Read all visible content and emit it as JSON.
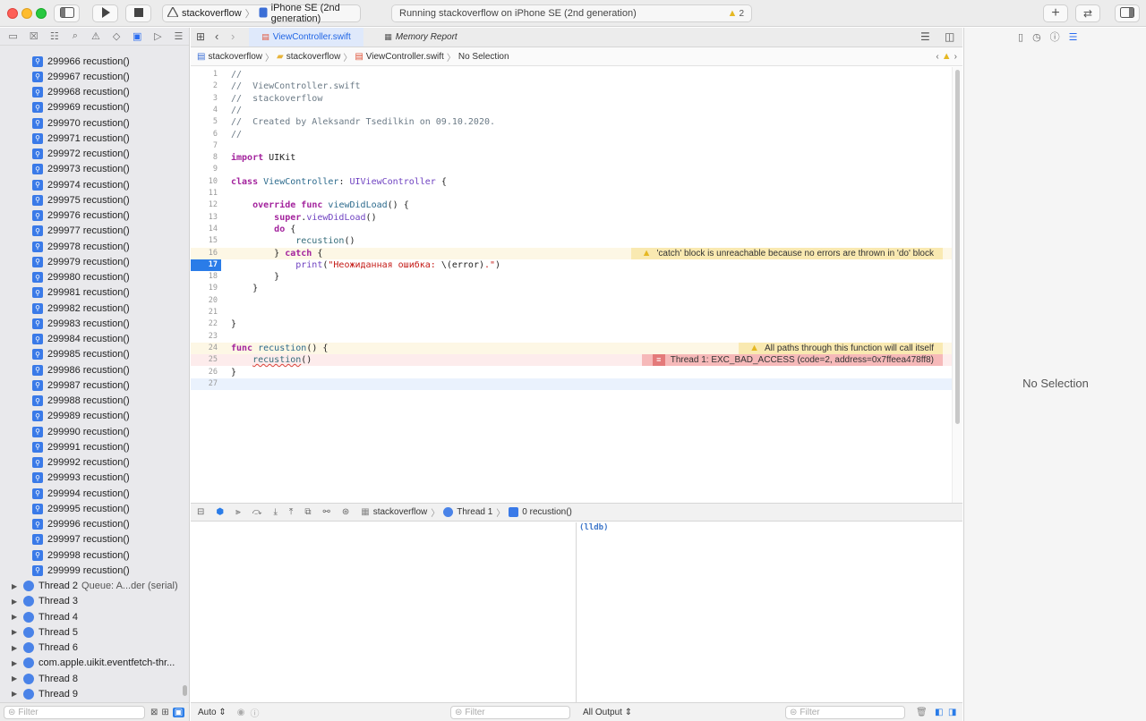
{
  "toolbar": {
    "scheme_project": "stackoverflow",
    "scheme_device": "iPhone SE (2nd generation)",
    "activity_status": "Running stackoverflow on iPhone SE (2nd generation)",
    "warning_count": "2"
  },
  "navigator": {
    "frames": [
      {
        "label": "299966 recustion()"
      },
      {
        "label": "299967 recustion()"
      },
      {
        "label": "299968 recustion()"
      },
      {
        "label": "299969 recustion()"
      },
      {
        "label": "299970 recustion()"
      },
      {
        "label": "299971 recustion()"
      },
      {
        "label": "299972 recustion()"
      },
      {
        "label": "299973 recustion()"
      },
      {
        "label": "299974 recustion()"
      },
      {
        "label": "299975 recustion()"
      },
      {
        "label": "299976 recustion()"
      },
      {
        "label": "299977 recustion()"
      },
      {
        "label": "299978 recustion()"
      },
      {
        "label": "299979 recustion()"
      },
      {
        "label": "299980 recustion()"
      },
      {
        "label": "299981 recustion()"
      },
      {
        "label": "299982 recustion()"
      },
      {
        "label": "299983 recustion()"
      },
      {
        "label": "299984 recustion()"
      },
      {
        "label": "299985 recustion()"
      },
      {
        "label": "299986 recustion()"
      },
      {
        "label": "299987 recustion()"
      },
      {
        "label": "299988 recustion()"
      },
      {
        "label": "299989 recustion()"
      },
      {
        "label": "299990 recustion()"
      },
      {
        "label": "299991 recustion()"
      },
      {
        "label": "299992 recustion()"
      },
      {
        "label": "299993 recustion()"
      },
      {
        "label": "299994 recustion()"
      },
      {
        "label": "299995 recustion()"
      },
      {
        "label": "299996 recustion()"
      },
      {
        "label": "299997 recustion()"
      },
      {
        "label": "299998 recustion()"
      },
      {
        "label": "299999 recustion()"
      }
    ],
    "threads": [
      {
        "label": "Thread 2",
        "sub": "Queue: A...der (serial)"
      },
      {
        "label": "Thread 3",
        "sub": ""
      },
      {
        "label": "Thread 4",
        "sub": ""
      },
      {
        "label": "Thread 5",
        "sub": ""
      },
      {
        "label": "Thread 6",
        "sub": ""
      },
      {
        "label": "com.apple.uikit.eventfetch-thr...",
        "sub": ""
      },
      {
        "label": "Thread 8",
        "sub": ""
      },
      {
        "label": "Thread 9",
        "sub": ""
      }
    ],
    "filter_placeholder": "Filter"
  },
  "editor": {
    "tabs": [
      {
        "label": "ViewController.swift",
        "active": true
      },
      {
        "label": "Memory Report",
        "active": false
      }
    ],
    "jumpbar": [
      "stackoverflow",
      "stackoverflow",
      "ViewController.swift",
      "No Selection"
    ],
    "lines": [
      {
        "n": "1",
        "html": "<span class=\"cm\">//</span>"
      },
      {
        "n": "2",
        "html": "<span class=\"cm\">//  ViewController.swift</span>"
      },
      {
        "n": "3",
        "html": "<span class=\"cm\">//  stackoverflow</span>"
      },
      {
        "n": "4",
        "html": "<span class=\"cm\">//</span>"
      },
      {
        "n": "5",
        "html": "<span class=\"cm\">//  Created by Aleksandr Tsedilkin on 09.10.2020.</span>"
      },
      {
        "n": "6",
        "html": "<span class=\"cm\">//</span>"
      },
      {
        "n": "7",
        "html": ""
      },
      {
        "n": "8",
        "html": "<span class=\"kw\">import</span> UIKit"
      },
      {
        "n": "9",
        "html": ""
      },
      {
        "n": "10",
        "html": "<span class=\"kw\">class</span> <span class=\"fn\">ViewController</span>: <span class=\"ty\">UIViewController</span> {"
      },
      {
        "n": "11",
        "html": ""
      },
      {
        "n": "12",
        "html": "    <span class=\"kw\">override</span> <span class=\"kw\">func</span> <span class=\"fn\">viewDidLoad</span>() {"
      },
      {
        "n": "13",
        "html": "        <span class=\"kw\">super</span>.<span class=\"ty\">viewDidLoad</span>()"
      },
      {
        "n": "14",
        "html": "        <span class=\"kw\">do</span> {"
      },
      {
        "n": "15",
        "html": "            <span class=\"fn2\">recustion</span>()"
      },
      {
        "n": "16",
        "html": "        } <span class=\"kw\">catch</span> {",
        "kind": "warn",
        "annotation": "'catch' block is unreachable because no errors are thrown in 'do' block"
      },
      {
        "n": "17",
        "html": "            <span class=\"ty\">print</span>(<span class=\"str\">\"Неожиданная ошибка: </span>\\(error)<span class=\"str\">.\"</span>)",
        "kind": "bp"
      },
      {
        "n": "18",
        "html": "        }"
      },
      {
        "n": "19",
        "html": "    }"
      },
      {
        "n": "20",
        "html": ""
      },
      {
        "n": "21",
        "html": ""
      },
      {
        "n": "22",
        "html": "}"
      },
      {
        "n": "23",
        "html": ""
      },
      {
        "n": "24",
        "html": "<span class=\"kw\">func</span> <span class=\"fn\">recustion</span>() {",
        "kind": "warn",
        "annotation": "All paths through this function will call itself"
      },
      {
        "n": "25",
        "html": "    <span class=\"fn2 ul\">recustion</span>()",
        "kind": "err",
        "annotation": "Thread 1: EXC_BAD_ACCESS (code=2, address=0x7ffeea478ff8)"
      },
      {
        "n": "26",
        "html": "}"
      },
      {
        "n": "27",
        "html": "",
        "kind": "cur"
      }
    ]
  },
  "debug": {
    "crumbs": [
      "stackoverflow",
      "Thread 1",
      "0 recustion()"
    ],
    "console_prompt": "(lldb)",
    "auto_label": "Auto",
    "all_output_label": "All Output",
    "filter_placeholder": "Filter"
  },
  "inspector": {
    "no_selection": "No Selection"
  },
  "colors": {
    "accent": "#2a7ce8",
    "warning": "#f9e9b1",
    "error": "#f6b9b9"
  }
}
